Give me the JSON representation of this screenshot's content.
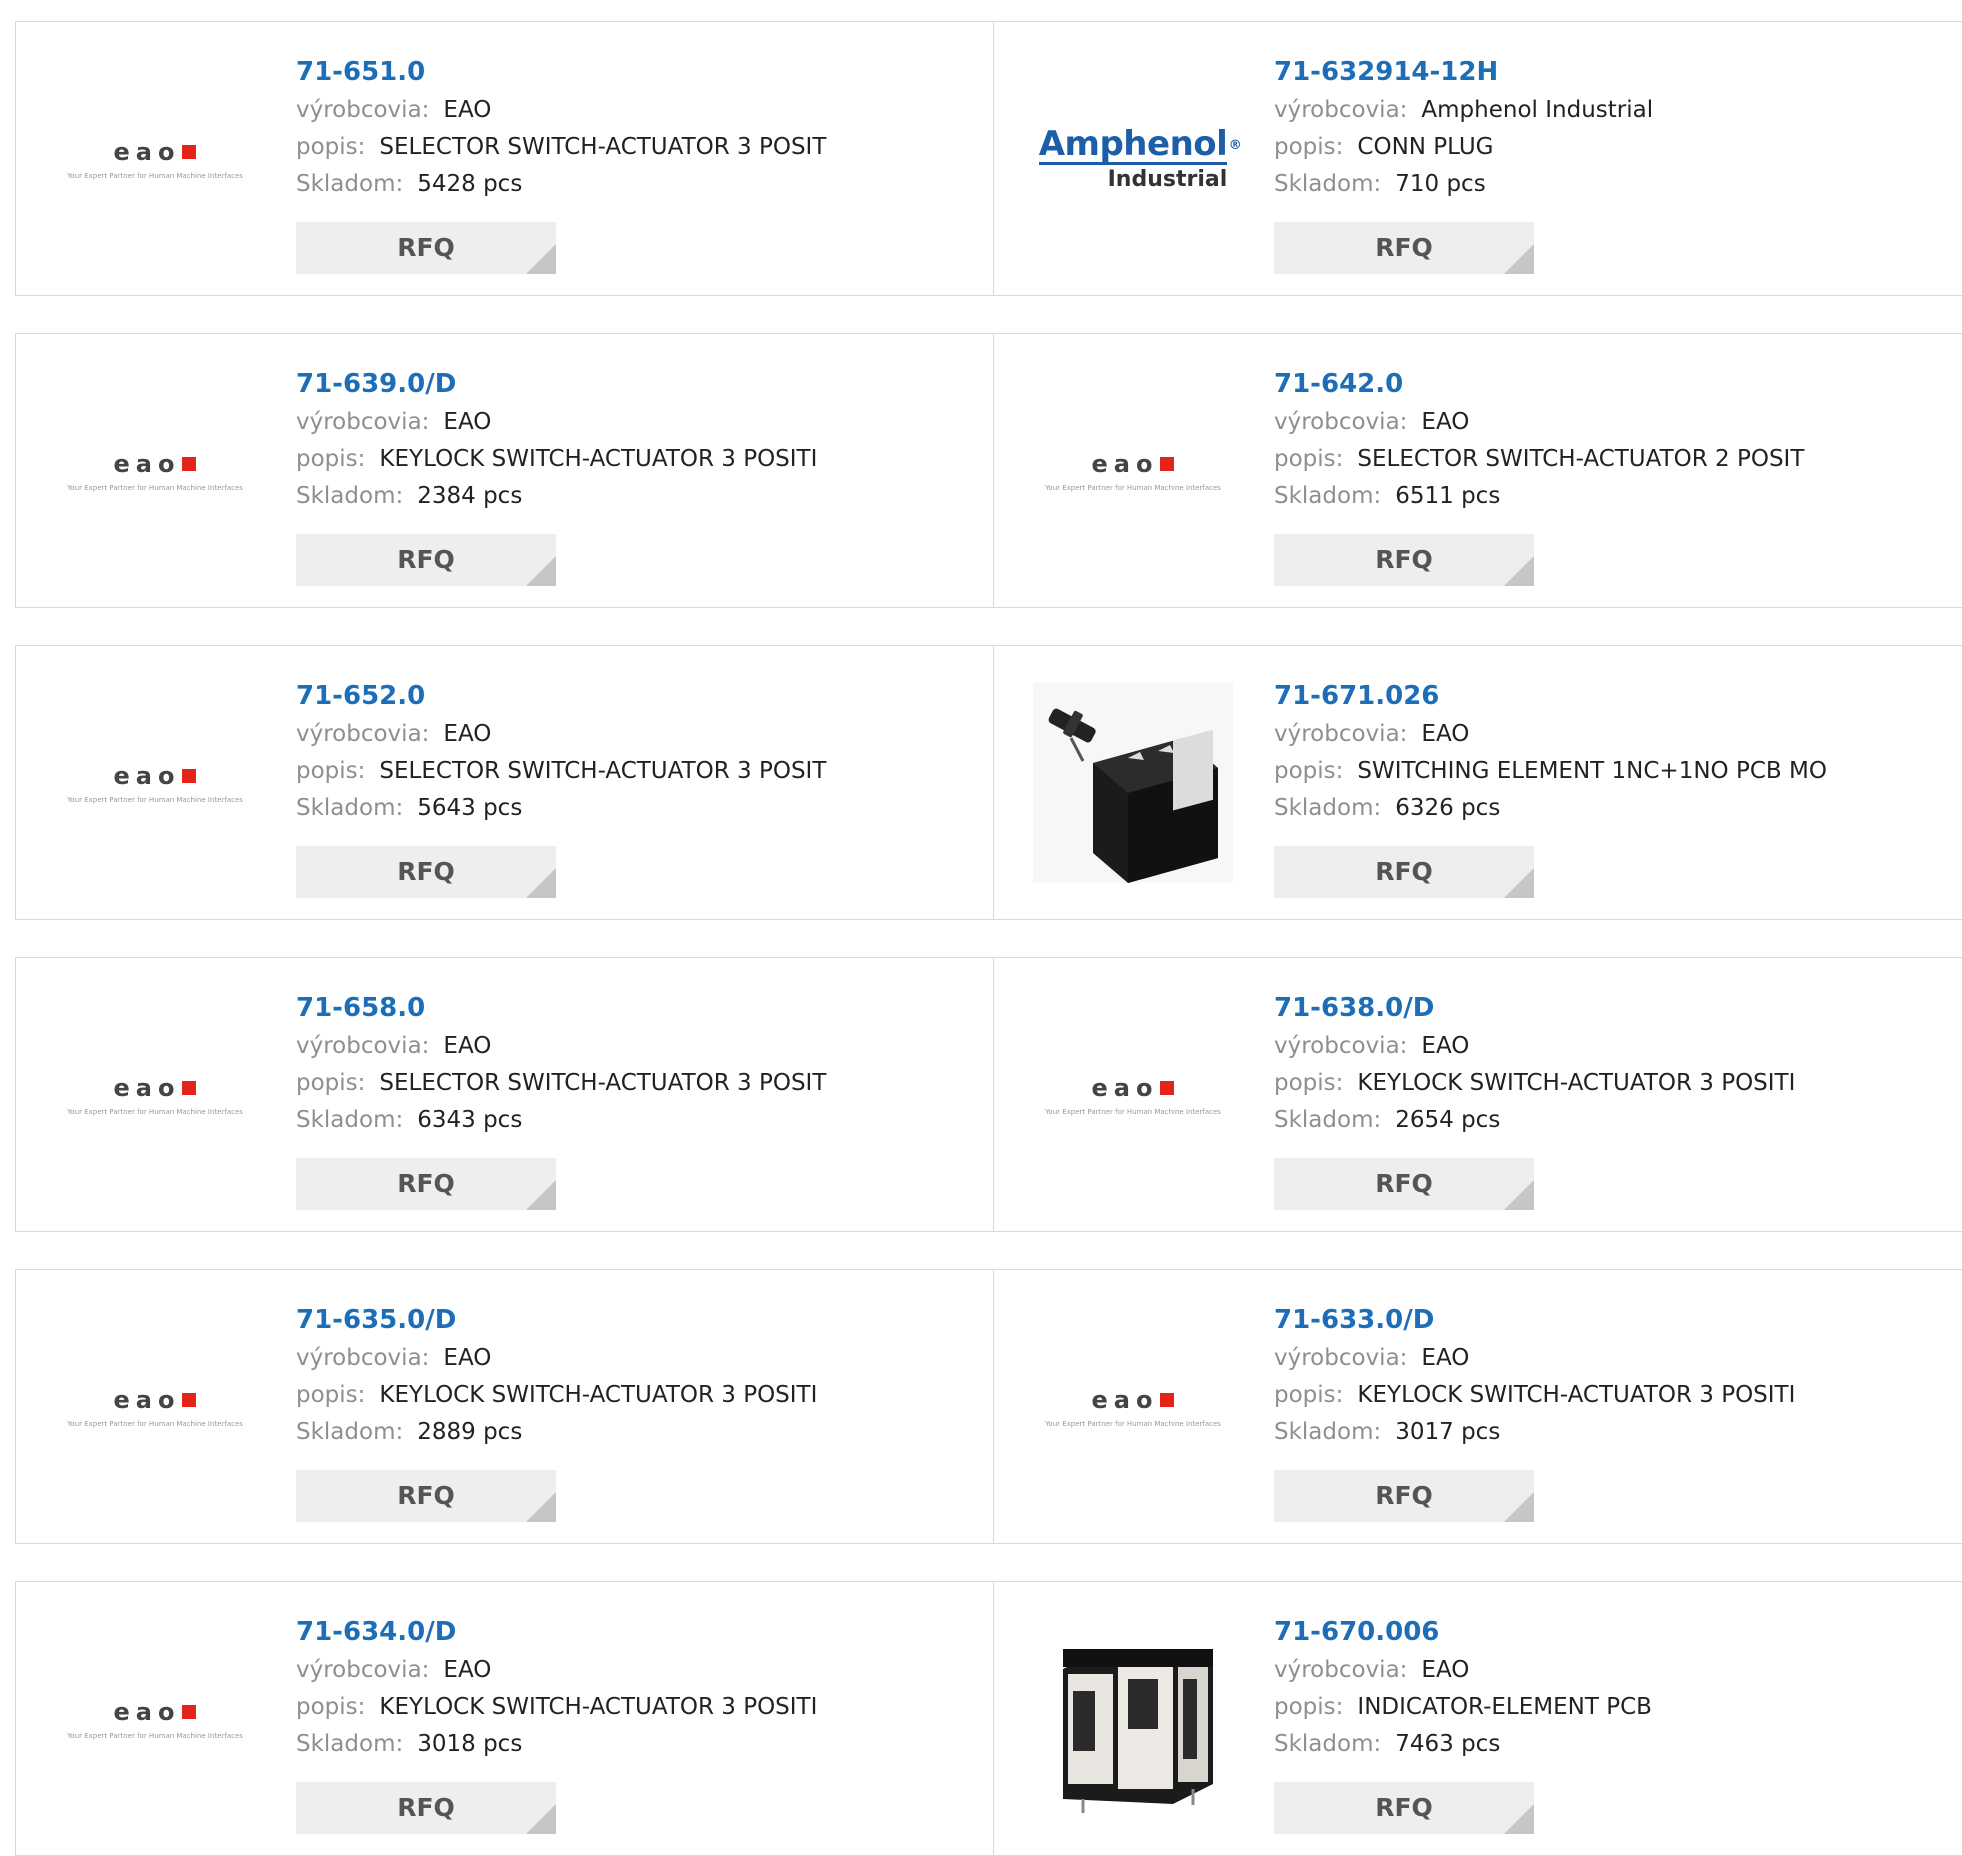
{
  "labels": {
    "manufacturer": "výrobcovia:",
    "description": "popis:",
    "stock": "Skladom:",
    "rfq": "RFQ"
  },
  "brand": {
    "eao_word": "eao",
    "eao_tagline": "Your Expert Partner for Human Machine Interfaces",
    "amphenol_word": "Amphenol",
    "amphenol_mark": "®",
    "amphenol_sub": "Industrial"
  },
  "colors": {
    "link": "#1e6db7",
    "eao_red": "#e2231a",
    "amphenol_blue": "#1d5ea8"
  },
  "products": [
    {
      "part": "71-651.0",
      "manufacturer": "EAO",
      "description": "SELECTOR SWITCH-ACTUATOR 3 POSIT",
      "stock": "5428 pcs",
      "image": "eao-logo"
    },
    {
      "part": "71-632914-12H",
      "manufacturer": "Amphenol Industrial",
      "description": "CONN PLUG",
      "stock": "710 pcs",
      "image": "amphenol-logo"
    },
    {
      "part": "71-639.0/D",
      "manufacturer": "EAO",
      "description": "KEYLOCK SWITCH-ACTUATOR 3 POSITI",
      "stock": "2384 pcs",
      "image": "eao-logo"
    },
    {
      "part": "71-642.0",
      "manufacturer": "EAO",
      "description": "SELECTOR SWITCH-ACTUATOR 2 POSIT",
      "stock": "6511 pcs",
      "image": "eao-logo"
    },
    {
      "part": "71-652.0",
      "manufacturer": "EAO",
      "description": "SELECTOR SWITCH-ACTUATOR 3 POSIT",
      "stock": "5643 pcs",
      "image": "eao-logo"
    },
    {
      "part": "71-671.026",
      "manufacturer": "EAO",
      "description": "SWITCHING ELEMENT 1NC+1NO PCB MO",
      "stock": "6326 pcs",
      "image": "switching-element-photo"
    },
    {
      "part": "71-658.0",
      "manufacturer": "EAO",
      "description": "SELECTOR SWITCH-ACTUATOR 3 POSIT",
      "stock": "6343 pcs",
      "image": "eao-logo"
    },
    {
      "part": "71-638.0/D",
      "manufacturer": "EAO",
      "description": "KEYLOCK SWITCH-ACTUATOR 3 POSITI",
      "stock": "2654 pcs",
      "image": "eao-logo"
    },
    {
      "part": "71-635.0/D",
      "manufacturer": "EAO",
      "description": "KEYLOCK SWITCH-ACTUATOR 3 POSITI",
      "stock": "2889 pcs",
      "image": "eao-logo"
    },
    {
      "part": "71-633.0/D",
      "manufacturer": "EAO",
      "description": "KEYLOCK SWITCH-ACTUATOR 3 POSITI",
      "stock": "3017 pcs",
      "image": "eao-logo"
    },
    {
      "part": "71-634.0/D",
      "manufacturer": "EAO",
      "description": "KEYLOCK SWITCH-ACTUATOR 3 POSITI",
      "stock": "3018 pcs",
      "image": "eao-logo"
    },
    {
      "part": "71-670.006",
      "manufacturer": "EAO",
      "description": "INDICATOR-ELEMENT PCB",
      "stock": "7463 pcs",
      "image": "indicator-element-photo"
    }
  ]
}
